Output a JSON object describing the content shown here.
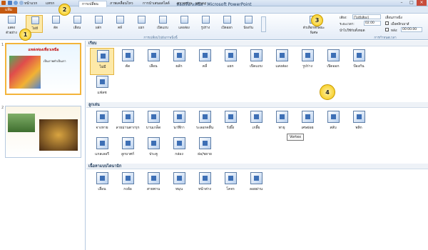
{
  "window": {
    "title": "ท่องเที่ยวเหนือ - Microsoft PowerPoint"
  },
  "tabs": {
    "file": "แฟ้ม",
    "items": [
      "หน้าแรก",
      "แทรก",
      "",
      "การเปลี่ยน",
      "ภาพเคลื่อนไหว",
      "การนำเสนอสไลด์",
      "ตรวจทาน",
      "มุมมอง"
    ]
  },
  "ribbon": {
    "preview": "แสดงตัวอย่าง",
    "buttons": [
      "ไม่มี",
      "ตัด",
      "เลือน",
      "ผลัก",
      "คลี่",
      "แยก",
      "เปิดแถบ",
      "แสงส่อง",
      "รูปร่าง",
      "เปิดออก",
      "ป้องกัน"
    ],
    "effect_options": "ตัวเลือกลักษณะพิเศษ",
    "group_label": "การเปลี่ยนไปยังภาพนิ่งนี้",
    "timing": {
      "sound_label": "เสียง:",
      "sound_value": "[ไม่มีเสียง]",
      "duration_label": "ระยะเวลา:",
      "duration_value": "02.00",
      "apply_all": "นำไปใช้กับทั้งหมด",
      "advance_label": "เลื่อนภาพนิ่ง",
      "on_click": "เมื่อคลิกเมาส์",
      "after_label": "หลัง:",
      "after_value": "00:00.00",
      "group_label": "การกำหนดเวลา"
    }
  },
  "slides": [
    {
      "number": "1",
      "title": "แหล่งท่องเที่ยวเหนือ",
      "subtitle": "เป็นภาพคำเป็นเรา"
    },
    {
      "number": "2"
    }
  ],
  "gallery": {
    "sections": [
      {
        "title": "เรียบ",
        "items": [
          "ไม่มี",
          "ตัด",
          "เลือน",
          "ผลัก",
          "คลี่",
          "แยก",
          "เปิดแถบ",
          "แสงส่อง",
          "รูปร่าง",
          "เปิดออก",
          "ป้องกัน",
          "แฟลช"
        ]
      },
      {
        "title": "ลูกเล่น",
        "items": [
          "จางหาย",
          "ลายม่านตากรุก",
          "บานเกล็ด",
          "นาฬิกา",
          "ระลอกคลื่น",
          "รังผึ้ง",
          "เกลี้ย",
          "พายุ",
          "เศษย่อย",
          "สลับ",
          "พลิก",
          "แกลเลอรี",
          "ลูกบาศก์",
          "ประตู",
          "กล่อง",
          "ย่อ/ขยาย"
        ]
      },
      {
        "title": "เนื้อหาแบบไดนามิก",
        "items": [
          "เลื่อน",
          "กงล้อ",
          "สายพาน",
          "หมุน",
          "หน้าต่าง",
          "โคจร",
          "ลอยผ่าน"
        ]
      }
    ],
    "tooltip": "Vortex"
  },
  "callouts": [
    "1",
    "2",
    "3",
    "4"
  ]
}
